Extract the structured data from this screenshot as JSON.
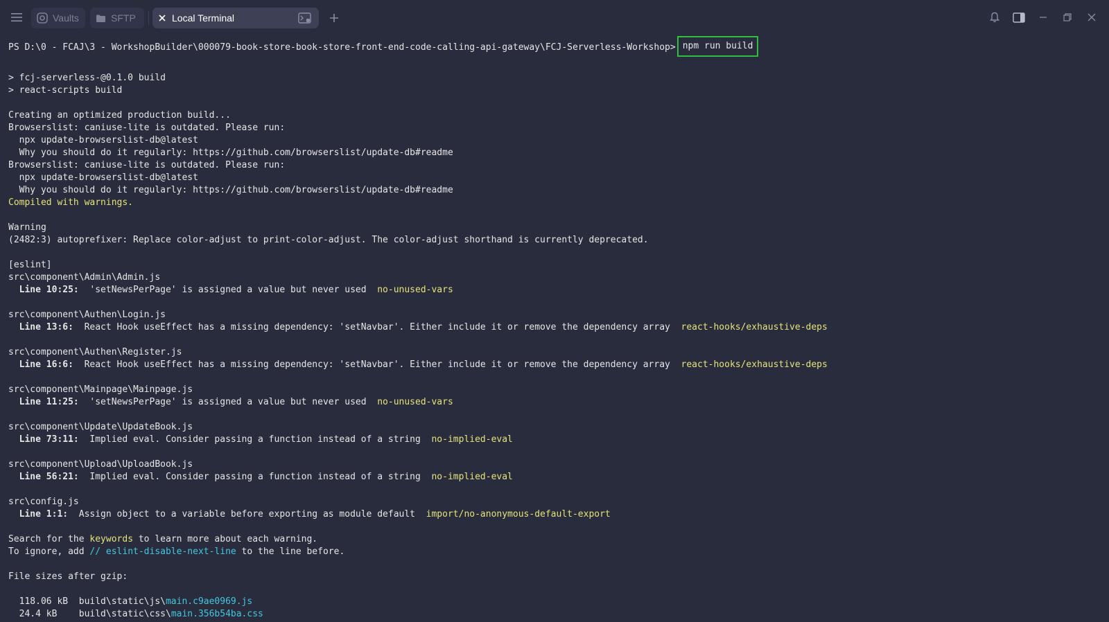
{
  "tabs": [
    {
      "label": "Vaults",
      "icon": "vault-icon"
    },
    {
      "label": "SFTP",
      "icon": "folder-icon"
    },
    {
      "label": "Local Terminal",
      "icon": "terminal-icon",
      "active": true
    }
  ],
  "colors": {
    "background": "#292c3d",
    "text": "#e6e6e6",
    "warning": "#e5e37a",
    "link": "#45c7e0",
    "highlight_box": "#2fbe3f"
  },
  "terminal": {
    "prompt": "PS D:\\0 - FCAJ\\3 - WorkshopBuilder\\000079-book-store-book-store-front-end-code-calling-api-gateway\\FCJ-Serverless-Workshop>",
    "command": "npm run build",
    "l_build1": "> fcj-serverless-@0.1.0 build",
    "l_build2": "> react-scripts build",
    "l_creating": "Creating an optimized production build...",
    "l_bl1": "Browserslist: caniuse-lite is outdated. Please run:",
    "l_npx1": "  npx update-browserslist-db@latest",
    "l_why1": "  Why you should do it regularly: https://github.com/browserslist/update-db#readme",
    "l_bl2": "Browserslist: caniuse-lite is outdated. Please run:",
    "l_npx2": "  npx update-browserslist-db@latest",
    "l_why2": "  Why you should do it regularly: https://github.com/browserslist/update-db#readme",
    "l_compiled": "Compiled with warnings.",
    "l_warning": "Warning",
    "l_autoprefixer": "(2482:3) autoprefixer: Replace color-adjust to print-color-adjust. The color-adjust shorthand is currently deprecated.",
    "l_eslint": "[eslint]",
    "warnings": [
      {
        "file": "src\\component\\Admin\\Admin.js",
        "loc": "  Line 10:25:",
        "msg": "  'setNewsPerPage' is assigned a value but never used  ",
        "rule": "no-unused-vars"
      },
      {
        "file": "src\\component\\Authen\\Login.js",
        "loc": "  Line 13:6:",
        "msg": "  React Hook useEffect has a missing dependency: 'setNavbar'. Either include it or remove the dependency array  ",
        "rule": "react-hooks/exhaustive-deps"
      },
      {
        "file": "src\\component\\Authen\\Register.js",
        "loc": "  Line 16:6:",
        "msg": "  React Hook useEffect has a missing dependency: 'setNavbar'. Either include it or remove the dependency array  ",
        "rule": "react-hooks/exhaustive-deps"
      },
      {
        "file": "src\\component\\Mainpage\\Mainpage.js",
        "loc": "  Line 11:25:",
        "msg": "  'setNewsPerPage' is assigned a value but never used  ",
        "rule": "no-unused-vars"
      },
      {
        "file": "src\\component\\Update\\UpdateBook.js",
        "loc": "  Line 73:11:",
        "msg": "  Implied eval. Consider passing a function instead of a string  ",
        "rule": "no-implied-eval"
      },
      {
        "file": "src\\component\\Upload\\UploadBook.js",
        "loc": "  Line 56:21:",
        "msg": "  Implied eval. Consider passing a function instead of a string  ",
        "rule": "no-implied-eval"
      },
      {
        "file": "src\\config.js",
        "loc": "  Line 1:1:",
        "msg": "  Assign object to a variable before exporting as module default  ",
        "rule": "import/no-anonymous-default-export"
      }
    ],
    "search_pre": "Search for the ",
    "search_kw": "keywords",
    "search_post": " to learn more about each warning.",
    "ignore_pre": "To ignore, add ",
    "ignore_kw": "// eslint-disable-next-line",
    "ignore_post": " to the line before.",
    "l_filesizes": "File sizes after gzip:",
    "files": [
      {
        "size": "  118.06 kB  ",
        "dir": "build\\static\\js\\",
        "name": "main.c9ae0969.js"
      },
      {
        "size": "  24.4 kB    ",
        "dir": "build\\static\\css\\",
        "name": "main.356b54ba.css"
      }
    ]
  }
}
